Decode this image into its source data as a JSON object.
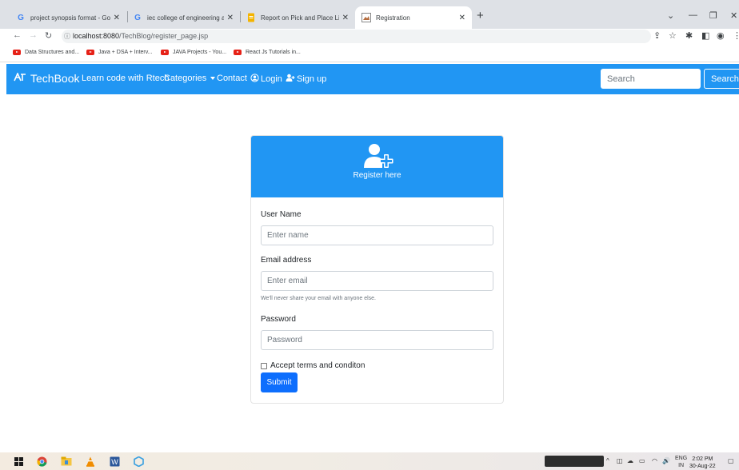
{
  "browser": {
    "tabs": [
      {
        "title": "project synopsis format - Google",
        "favicon": "G"
      },
      {
        "title": "iec college of engineering and te",
        "favicon": "G"
      },
      {
        "title": "Report on Pick and Place Line fol",
        "favicon": "doc"
      },
      {
        "title": "Registration",
        "favicon": "img"
      }
    ],
    "url_host": "localhost:8080",
    "url_path": "/TechBlog/register_page.jsp",
    "bookmarks": [
      "Data Structures and...",
      "Java + DSA + Interv...",
      "JAVA Projects - You...",
      "React Js Tutorials in..."
    ]
  },
  "navbar": {
    "brand": "TechBook",
    "links": {
      "learn": "Learn code with Rtech",
      "categories": "Categories",
      "contact": "Contact",
      "login": "Login",
      "signup": "Sign up"
    },
    "search_placeholder": "Search",
    "search_button": "Search"
  },
  "register": {
    "title": "Register here",
    "username_label": "User Name",
    "username_placeholder": "Enter name",
    "email_label": "Email address",
    "email_placeholder": "Enter email",
    "email_help": "We'll never share your email with anyone else.",
    "password_label": "Password",
    "password_placeholder": "Password",
    "terms_label": "Accept terms and conditon",
    "submit_label": "Submit"
  },
  "taskbar": {
    "language": "ENG",
    "region": "IN",
    "time": "2:02 PM",
    "date": "30-Aug-22"
  },
  "colors": {
    "primary": "#2196f3",
    "submit": "#0d6efd"
  }
}
